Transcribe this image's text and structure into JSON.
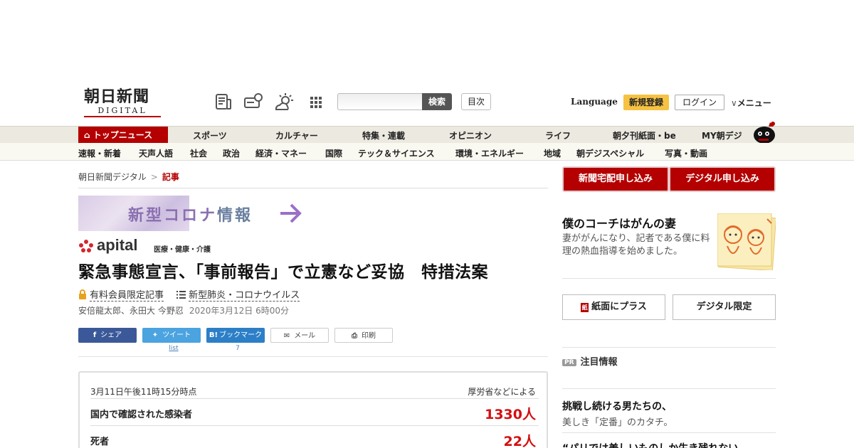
{
  "header": {
    "logo_main": "朝日新聞",
    "logo_sub": "DIGITAL",
    "search_placeholder": "",
    "search_button": "検索",
    "toc_button": "目次",
    "language": "Language",
    "register": "新規登録",
    "login": "ログイン",
    "menu": "メニュー"
  },
  "nav_primary": {
    "top_news": "トップニュース",
    "items": [
      "スポーツ",
      "カルチャー",
      "特集・連載",
      "オピニオン",
      "ライフ",
      "朝夕刊紙面・be",
      "MY朝デジ"
    ]
  },
  "nav_secondary": {
    "items": [
      "速報・新着",
      "天声人語",
      "社会",
      "政治",
      "経済・マネー",
      "国際",
      "テック＆サイエンス",
      "環境・エネルギー",
      "地域",
      "朝デジスペシャル",
      "写真・動画"
    ]
  },
  "breadcrumb": {
    "home": "朝日新聞デジタル",
    "sep": ">",
    "current": "記事"
  },
  "corona_banner": {
    "text_a": "新型コロナ",
    "text_b": "情報"
  },
  "apital": {
    "name": "apital",
    "tagline": "医療・健康・介護"
  },
  "article": {
    "headline": "緊急事態宣言、「事前報告」で立憲など妥協　特措法案",
    "premium_label": "有料会員限定記事",
    "topic_label": "新型肺炎・コロナウイルス",
    "authors": "安倍龍太郎、永田大 今野忍",
    "date": "2020年3月12日 6時00分"
  },
  "share": {
    "facebook": "シェア",
    "twitter": "ツイート",
    "hatena": "ブックマーク",
    "mail": "メール",
    "print": "印刷",
    "twitter_count": "list",
    "hatena_count": "7"
  },
  "stats": {
    "timestamp": "3月11日午後11時15分時点",
    "source": "厚労省などによる",
    "rows": [
      {
        "label": "国内で確認された感染者",
        "value": "1330人"
      },
      {
        "label": "死者",
        "value": "22人"
      }
    ]
  },
  "sidebar": {
    "btn_home_delivery": "新聞宅配申し込み",
    "btn_digital": "デジタル申し込み",
    "coach_title": "僕のコーチはがんの妻",
    "coach_desc": "妻ががんになり、記者である僕に料理の熱血指導を始めました。",
    "btn_paper_plus": "紙面にプラス",
    "btn_digital_only": "デジタル限定",
    "pr_badge": "PR",
    "pr_heading": "注目情報",
    "pr_title": "挑戦し続ける男たちの、",
    "pr_desc": "美しき「定番」のカタチ。",
    "pr_next": "“パリでは美しいものしか生き残れない"
  },
  "colors": {
    "brand_red": "#b40000",
    "stat_red": "#d30f0f",
    "accent_yellow": "#f5c243"
  }
}
